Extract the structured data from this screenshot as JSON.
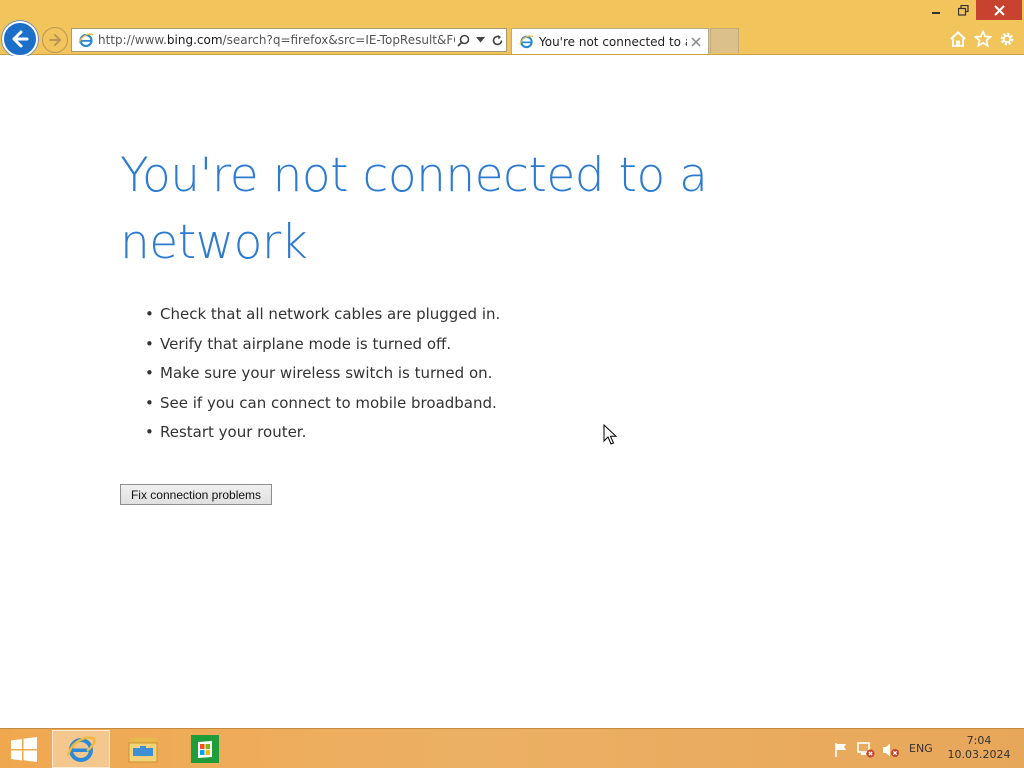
{
  "browser": {
    "url_prefix": "http://www.",
    "url_domain": "bing.com",
    "url_path": "/search?q=firefox&src=IE-TopResult&FORM=",
    "tab_title": "You're not connected to a ..."
  },
  "page": {
    "headline": "You're not connected to a network",
    "tips": [
      "Check that all network cables are plugged in.",
      "Verify that airplane mode is turned off.",
      "Make sure your wireless switch is turned on.",
      "See if you can connect to mobile broadband.",
      "Restart your router."
    ],
    "fix_button": "Fix connection problems"
  },
  "taskbar": {
    "language": "ENG",
    "time": "7:04",
    "date": "10.03.2024"
  },
  "colors": {
    "chrome": "#f2c55c",
    "headline": "#2d7bd1",
    "close_button": "#c7432f"
  }
}
